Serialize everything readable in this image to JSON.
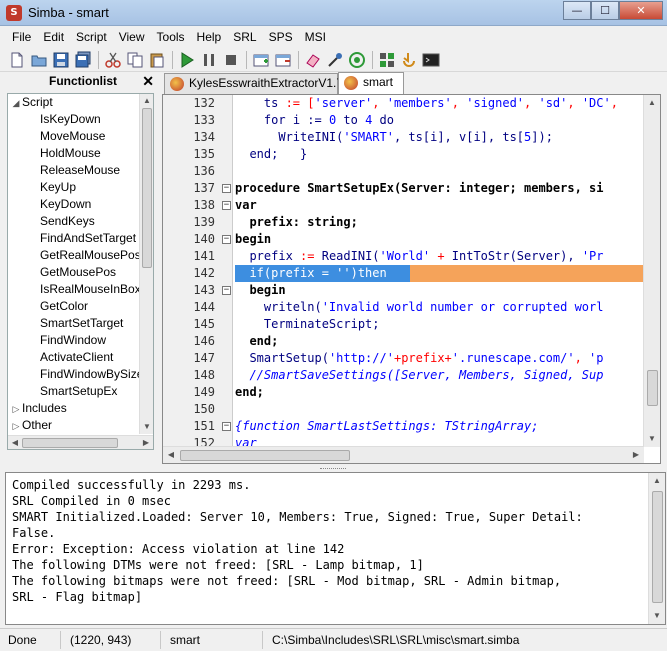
{
  "window": {
    "title": "Simba - smart",
    "minimize": "—",
    "maximize": "☐",
    "close": "✕"
  },
  "menu": [
    "File",
    "Edit",
    "Script",
    "View",
    "Tools",
    "Help",
    "SRL",
    "SPS",
    "MSI"
  ],
  "function_list": {
    "title": "Functionlist",
    "close": "✕",
    "items": [
      {
        "label": "Script",
        "arrow": "◢"
      },
      {
        "label": "IsKeyDown"
      },
      {
        "label": "MoveMouse"
      },
      {
        "label": "HoldMouse"
      },
      {
        "label": "ReleaseMouse"
      },
      {
        "label": "KeyUp"
      },
      {
        "label": "KeyDown"
      },
      {
        "label": "SendKeys"
      },
      {
        "label": "FindAndSetTarget"
      },
      {
        "label": "GetRealMousePos"
      },
      {
        "label": "GetMousePos"
      },
      {
        "label": "IsRealMouseInBox"
      },
      {
        "label": "GetColor"
      },
      {
        "label": "SmartSetTarget"
      },
      {
        "label": "FindWindow"
      },
      {
        "label": "ActivateClient"
      },
      {
        "label": "FindWindowBySize"
      },
      {
        "label": "SmartSetupEx"
      },
      {
        "label": "Includes",
        "arrow": "▷"
      },
      {
        "label": "Other",
        "arrow": "▷"
      }
    ]
  },
  "tabs": [
    {
      "label": "KylesEsswraithExtractorV1.7",
      "active": false
    },
    {
      "label": "smart",
      "active": true
    }
  ],
  "editor": {
    "lines": [
      {
        "n": "132",
        "fold": "",
        "tokens": [
          [
            "    ",
            ""
          ],
          [
            "ts",
            "id"
          ],
          [
            " := [",
            "sym"
          ],
          [
            "'server'",
            "str"
          ],
          [
            ", ",
            "sym"
          ],
          [
            "'members'",
            "str"
          ],
          [
            ", ",
            "sym"
          ],
          [
            "'signed'",
            "str"
          ],
          [
            ", ",
            "sym"
          ],
          [
            "'sd'",
            "str"
          ],
          [
            ", ",
            "sym"
          ],
          [
            "'DC'",
            "str"
          ],
          [
            ", ",
            "sym"
          ]
        ]
      },
      {
        "n": "133",
        "fold": "",
        "tokens": [
          [
            "    ",
            ""
          ],
          [
            "for",
            "id"
          ],
          [
            " i := ",
            "id"
          ],
          [
            "0",
            "num"
          ],
          [
            " to ",
            "id"
          ],
          [
            "4",
            "num"
          ],
          [
            " do",
            "id"
          ]
        ]
      },
      {
        "n": "134",
        "fold": "",
        "tokens": [
          [
            "      ",
            ""
          ],
          [
            "WriteINI(",
            "id"
          ],
          [
            "'SMART'",
            "str"
          ],
          [
            ", ts[i], v[i], ts[",
            "id"
          ],
          [
            "5",
            "num"
          ],
          [
            "]);",
            "id"
          ]
        ]
      },
      {
        "n": "135",
        "fold": "",
        "tokens": [
          [
            "  ",
            ""
          ],
          [
            "end;",
            "id"
          ],
          [
            "   }",
            "id"
          ]
        ]
      },
      {
        "n": "136",
        "fold": "",
        "tokens": []
      },
      {
        "n": "137",
        "fold": "−",
        "tokens": [
          [
            "procedure",
            "kw"
          ],
          [
            " SmartSetupEx(Server: integer; members, si",
            "kw"
          ]
        ]
      },
      {
        "n": "138",
        "fold": "−",
        "tokens": [
          [
            "var",
            "kw"
          ]
        ]
      },
      {
        "n": "139",
        "fold": "",
        "tokens": [
          [
            "  ",
            ""
          ],
          [
            "prefix: string;",
            "kw"
          ]
        ]
      },
      {
        "n": "140",
        "fold": "−",
        "tokens": [
          [
            "begin",
            "kw"
          ]
        ]
      },
      {
        "n": "141",
        "fold": "",
        "tokens": [
          [
            "  ",
            ""
          ],
          [
            "prefix",
            "id"
          ],
          [
            " := ",
            "sym"
          ],
          [
            "ReadINI(",
            "id"
          ],
          [
            "'World'",
            "str"
          ],
          [
            " + ",
            "sym"
          ],
          [
            "IntToStr(Server), ",
            "id"
          ],
          [
            "'Pr",
            "str"
          ]
        ]
      },
      {
        "n": "142",
        "fold": "",
        "tokens": [
          [
            "  if(prefix = '')then",
            "white"
          ]
        ],
        "highlight": true
      },
      {
        "n": "143",
        "fold": "−",
        "tokens": [
          [
            "  ",
            ""
          ],
          [
            "begin",
            "kw"
          ]
        ]
      },
      {
        "n": "144",
        "fold": "",
        "tokens": [
          [
            "    ",
            ""
          ],
          [
            "writeln(",
            "id"
          ],
          [
            "'Invalid world number or corrupted worl",
            "str"
          ]
        ]
      },
      {
        "n": "145",
        "fold": "",
        "tokens": [
          [
            "    ",
            ""
          ],
          [
            "TerminateScript;",
            "id"
          ]
        ]
      },
      {
        "n": "146",
        "fold": "",
        "tokens": [
          [
            "  ",
            ""
          ],
          [
            "end;",
            "kw"
          ]
        ]
      },
      {
        "n": "147",
        "fold": "",
        "tokens": [
          [
            "  ",
            ""
          ],
          [
            "SmartSetup(",
            "id"
          ],
          [
            "'http://'",
            "str"
          ],
          [
            "+prefix+",
            "sym"
          ],
          [
            "'.runescape.com/'",
            "str"
          ],
          [
            ", ",
            "sym"
          ],
          [
            "'p",
            "str"
          ]
        ]
      },
      {
        "n": "148",
        "fold": "",
        "tokens": [
          [
            "  ",
            ""
          ],
          [
            "//SmartSaveSettings([Server, Members, Signed, Sup",
            "com"
          ]
        ]
      },
      {
        "n": "149",
        "fold": "",
        "tokens": [
          [
            "end;",
            "kw"
          ]
        ]
      },
      {
        "n": "150",
        "fold": "",
        "tokens": []
      },
      {
        "n": "151",
        "fold": "−",
        "tokens": [
          [
            "{function SmartLastSettings: TStringArray;",
            "com"
          ]
        ]
      },
      {
        "n": "152",
        "fold": "",
        "tokens": [
          [
            "var",
            "com"
          ]
        ]
      }
    ]
  },
  "debug": {
    "lines": [
      "Compiled successfully in 2293 ms.",
      "SRL Compiled in 0 msec",
      "SMART Initialized.Loaded: Server 10, Members: True, Signed: True, Super Detail:",
      "False.",
      "Error: Exception: Access violation at line 142",
      "The following DTMs were not freed: [SRL - Lamp bitmap, 1]",
      "The following bitmaps were not freed: [SRL - Mod bitmap, SRL - Admin bitmap,",
      "SRL - Flag bitmap]"
    ]
  },
  "status": {
    "state": "Done",
    "cursor": "(1220, 943)",
    "script": "smart",
    "path": "C:\\Simba\\Includes\\SRL\\SRL\\misc\\smart.simba"
  },
  "colors": {
    "highlight_blue": "#3d8ee0",
    "highlight_orange": "#f5a35a",
    "keyword": "#000000",
    "identifier": "#000080",
    "string": "#0000ff",
    "symbol": "#ff0000"
  }
}
